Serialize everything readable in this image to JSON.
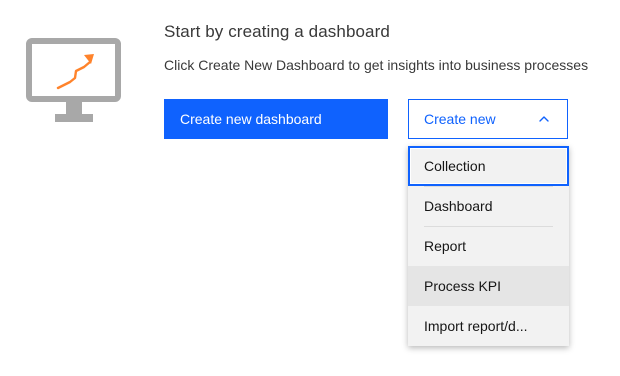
{
  "empty_state": {
    "title": "Start by creating a dashboard",
    "subtitle": "Click Create New Dashboard to get insights into business processes",
    "illustration_icon": "monitor-growth-icon"
  },
  "actions": {
    "primary_label": "Create new dashboard",
    "dropdown_label": "Create new",
    "dropdown_icon": "chevron-up-icon"
  },
  "menu": {
    "items": [
      {
        "label": "Collection",
        "state": "focused"
      },
      {
        "label": "Dashboard",
        "state": "normal"
      },
      {
        "label": "Report",
        "state": "normal"
      },
      {
        "label": "Process KPI",
        "state": "hovered"
      },
      {
        "label": "Import report/d...",
        "state": "normal"
      }
    ]
  },
  "colors": {
    "primary": "#0f62fe",
    "illustration_gray": "#a8a8a8",
    "illustration_accent": "#ff832b",
    "menu_background": "#f2f2f2",
    "menu_hover": "#e5e5e5"
  }
}
